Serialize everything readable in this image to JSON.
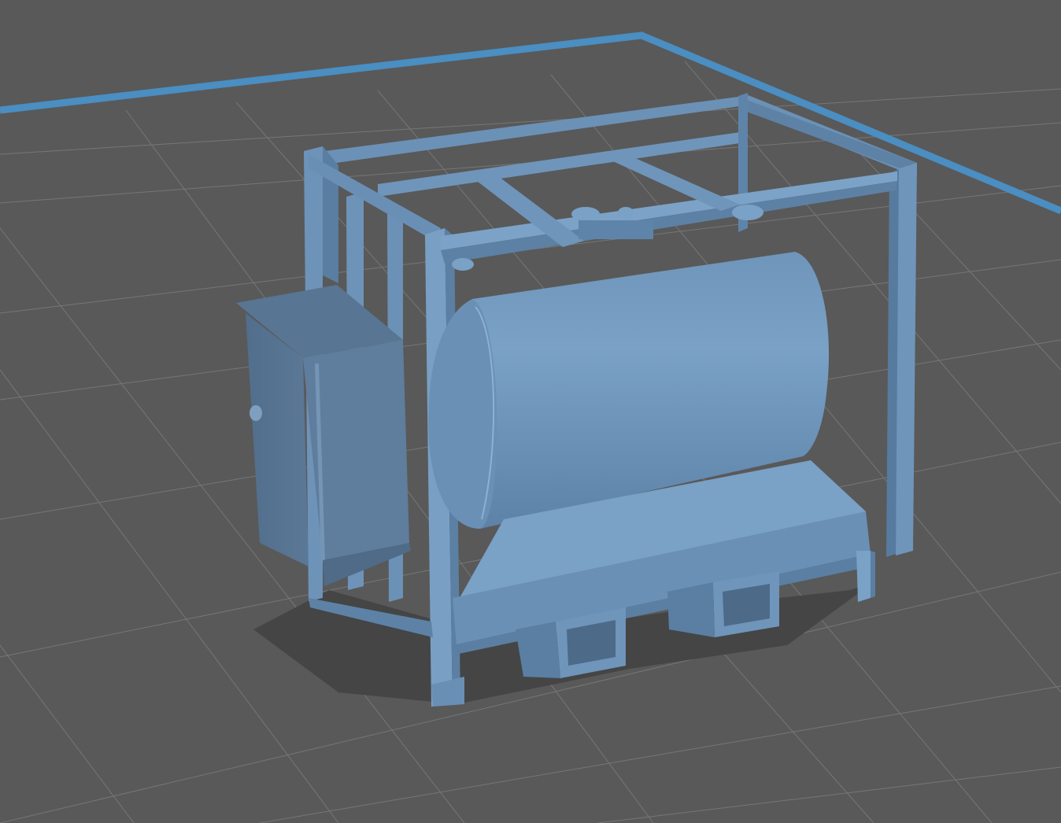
{
  "viewport": {
    "background": "#595959",
    "grid_color": "#7c7c7c",
    "bed_border_color": "#4a8ec2"
  },
  "model": {
    "name_icon": "tank-container-3d-model",
    "base_color": "#6e94b8",
    "light_color": "#7ea5c8",
    "dark_color": "#4f6b87",
    "shadow_color": "#454545"
  }
}
